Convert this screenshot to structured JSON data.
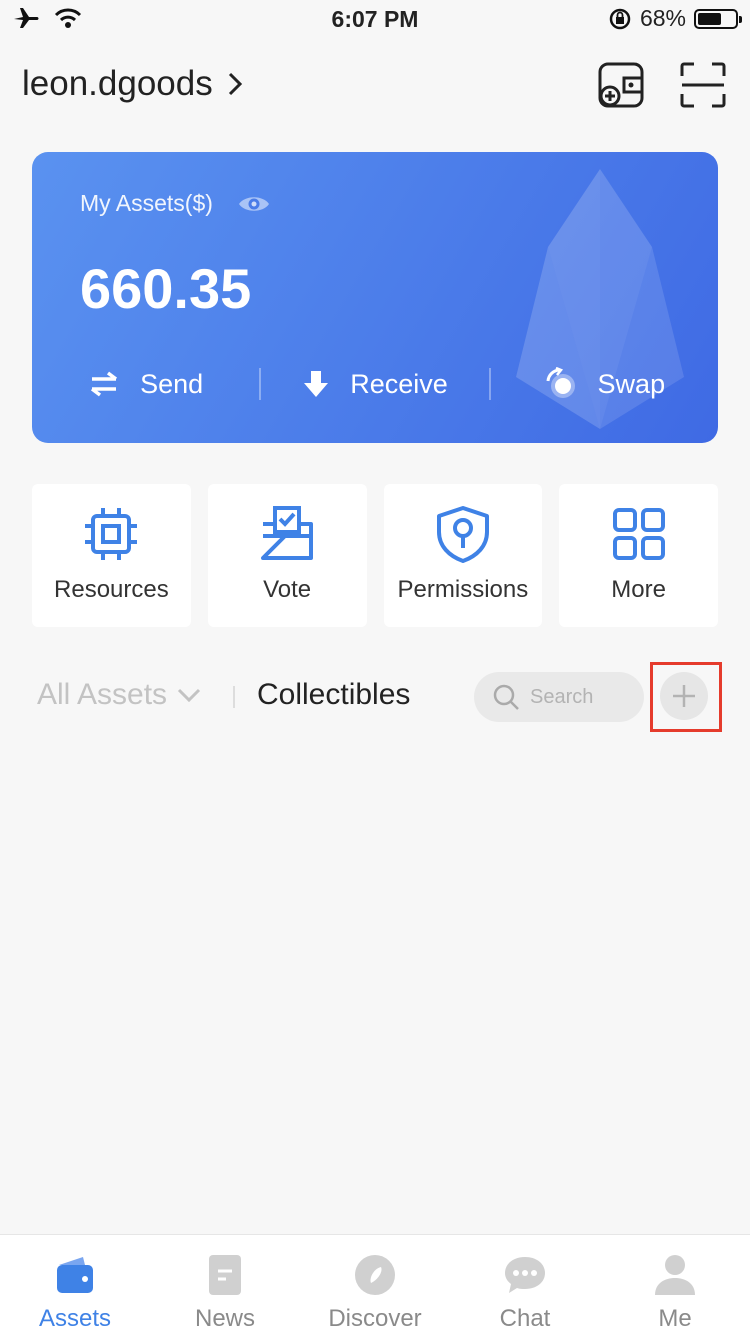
{
  "status_bar": {
    "time": "6:07 PM",
    "battery_percent": "68%",
    "battery_level": 0.68
  },
  "header": {
    "account_name": "leon.dgoods",
    "icons": [
      "wallet-add-icon",
      "scan-icon"
    ]
  },
  "asset_card": {
    "title": "My Assets($)",
    "value": "660.35",
    "actions": [
      {
        "label": "Send",
        "icon": "transfer-arrows-icon"
      },
      {
        "label": "Receive",
        "icon": "download-arrow-icon"
      },
      {
        "label": "Swap",
        "icon": "swap-icon"
      }
    ]
  },
  "quick_actions": [
    {
      "label": "Resources",
      "icon": "chip-icon"
    },
    {
      "label": "Vote",
      "icon": "ballot-box-icon"
    },
    {
      "label": "Permissions",
      "icon": "shield-key-icon"
    },
    {
      "label": "More",
      "icon": "grid-icon"
    }
  ],
  "asset_tabs": {
    "all_assets": "All Assets",
    "collectibles": "Collectibles",
    "search_placeholder": "Search"
  },
  "bottom_nav": [
    {
      "label": "Assets",
      "icon": "wallet-icon",
      "active": true
    },
    {
      "label": "News",
      "icon": "document-icon",
      "active": false
    },
    {
      "label": "Discover",
      "icon": "compass-icon",
      "active": false
    },
    {
      "label": "Chat",
      "icon": "chat-bubble-icon",
      "active": false
    },
    {
      "label": "Me",
      "icon": "person-icon",
      "active": false
    }
  ],
  "colors": {
    "accent": "#3f82e6",
    "card_gradient_start": "#5a92f0",
    "card_gradient_end": "#3f6ae4",
    "highlight": "#e53b2c"
  }
}
